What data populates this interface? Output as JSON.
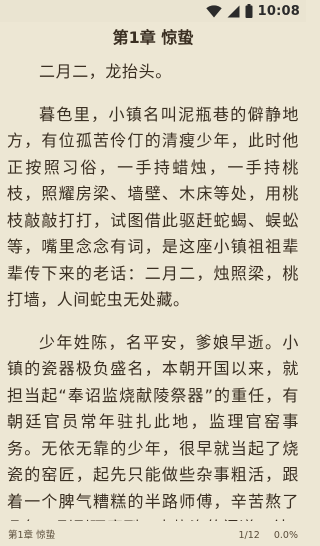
{
  "status_bar": {
    "time": "10:08",
    "icons": [
      "wifi-icon",
      "signal-icon",
      "battery-icon"
    ]
  },
  "reader": {
    "chapter_title": "第1章 惊蛰",
    "paragraphs": [
      "二月二，龙抬头。",
      "暮色里，小镇名叫泥瓶巷的僻静地方，有位孤苦伶仃的清瘦少年，此时他正按照习俗，一手持蜡烛，一手持桃枝，照耀房梁、墙壁、木床等处，用桃枝敲敲打打，试图借此驱赶蛇蝎、蜈蚣等，嘴里念念有词，是这座小镇祖祖辈辈传下来的老话：二月二，烛照梁，桃打墙，人间蛇虫无处藏。",
      "少年姓陈，名平安，爹娘早逝。小镇的瓷器极负盛名，本朝开国以来，就担当起“奉诏监烧献陵祭器”的重任，有朝廷官员常年驻扎此地，监理官窑事务。无依无靠的少年，很早就当起了烧瓷的窑匠，起先只能做些杂事粗活，跟着一个脾气糟糕的半路师傅，辛苦熬了几年，刚刚琢磨到一点烧瓷的门道，结"
    ]
  },
  "footer": {
    "chapter": "第1章 惊蛰",
    "page": "1/12",
    "progress": "0.0%"
  },
  "colors": {
    "background": "#ede7d4",
    "text": "#3a2f22"
  }
}
